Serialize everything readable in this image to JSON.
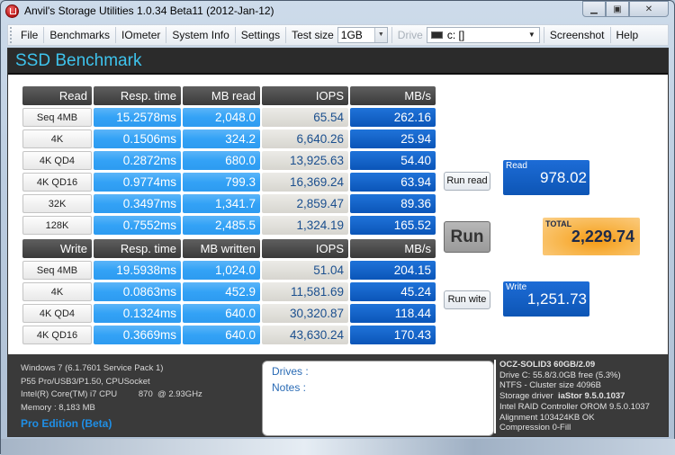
{
  "window": {
    "title": "Anvil's Storage Utilities 1.0.34 Beta11 (2012-Jan-12)",
    "controls": [
      "minimize",
      "maximize",
      "close"
    ]
  },
  "menu": {
    "items": [
      "File",
      "Benchmarks",
      "IOmeter",
      "System Info",
      "Settings"
    ],
    "test_size_label": "Test size",
    "test_size_value": "1GB",
    "drive_label": "Drive",
    "drive_value": "c: []",
    "screenshot": "Screenshot",
    "help": "Help"
  },
  "header": {
    "title": "SSD Benchmark"
  },
  "read_table": {
    "headers": [
      "Read",
      "Resp. time",
      "MB read",
      "IOPS",
      "MB/s"
    ],
    "rows": [
      [
        "Seq 4MB",
        "15.2578ms",
        "2,048.0",
        "65.54",
        "262.16"
      ],
      [
        "4K",
        "0.1506ms",
        "324.2",
        "6,640.26",
        "25.94"
      ],
      [
        "4K QD4",
        "0.2872ms",
        "680.0",
        "13,925.63",
        "54.40"
      ],
      [
        "4K QD16",
        "0.9774ms",
        "799.3",
        "16,369.24",
        "63.94"
      ],
      [
        "32K",
        "0.3497ms",
        "1,341.7",
        "2,859.47",
        "89.36"
      ],
      [
        "128K",
        "0.7552ms",
        "2,485.5",
        "1,324.19",
        "165.52"
      ]
    ]
  },
  "write_table": {
    "headers": [
      "Write",
      "Resp. time",
      "MB written",
      "IOPS",
      "MB/s"
    ],
    "rows": [
      [
        "Seq 4MB",
        "19.5938ms",
        "1,024.0",
        "51.04",
        "204.15"
      ],
      [
        "4K",
        "0.0863ms",
        "452.9",
        "11,581.69",
        "45.24"
      ],
      [
        "4K QD4",
        "0.1324ms",
        "640.0",
        "30,320.87",
        "118.44"
      ],
      [
        "4K QD16",
        "0.3669ms",
        "640.0",
        "43,630.24",
        "170.43"
      ]
    ]
  },
  "controls": {
    "run_read": "Run read",
    "run": "Run",
    "run_write": "Run wite"
  },
  "scores": {
    "read_label": "Read",
    "read_value": "978.02",
    "total_label": "TOTAL",
    "total_value": "2,229.74",
    "write_label": "Write",
    "write_value": "1,251.73"
  },
  "system_info": {
    "lines": [
      "Windows 7 (6.1.7601 Service Pack 1)",
      "P55 Pro/USB3/P1.50, CPUSocket",
      "Intel(R) Core(TM) i7 CPU         870  @ 2.93GHz",
      "Memory : 8,183 MB"
    ],
    "edition": "Pro Edition (Beta)"
  },
  "notes": {
    "drives_label": "Drives :",
    "notes_label": "Notes :"
  },
  "drive_info": {
    "model": "OCZ-SOLID3 60GB/2.09",
    "free": "Drive C: 55.8/3.0GB free (5.3%)",
    "fs": "NTFS - Cluster size 4096B",
    "driver_label": "Storage driver",
    "driver_value": "iaStor 9.5.0.1037",
    "orom": "Intel RAID Controller OROM 9.5.0.1037",
    "alignment": "Alignment 103424KB OK",
    "compression": "Compression 0-Fill"
  }
}
